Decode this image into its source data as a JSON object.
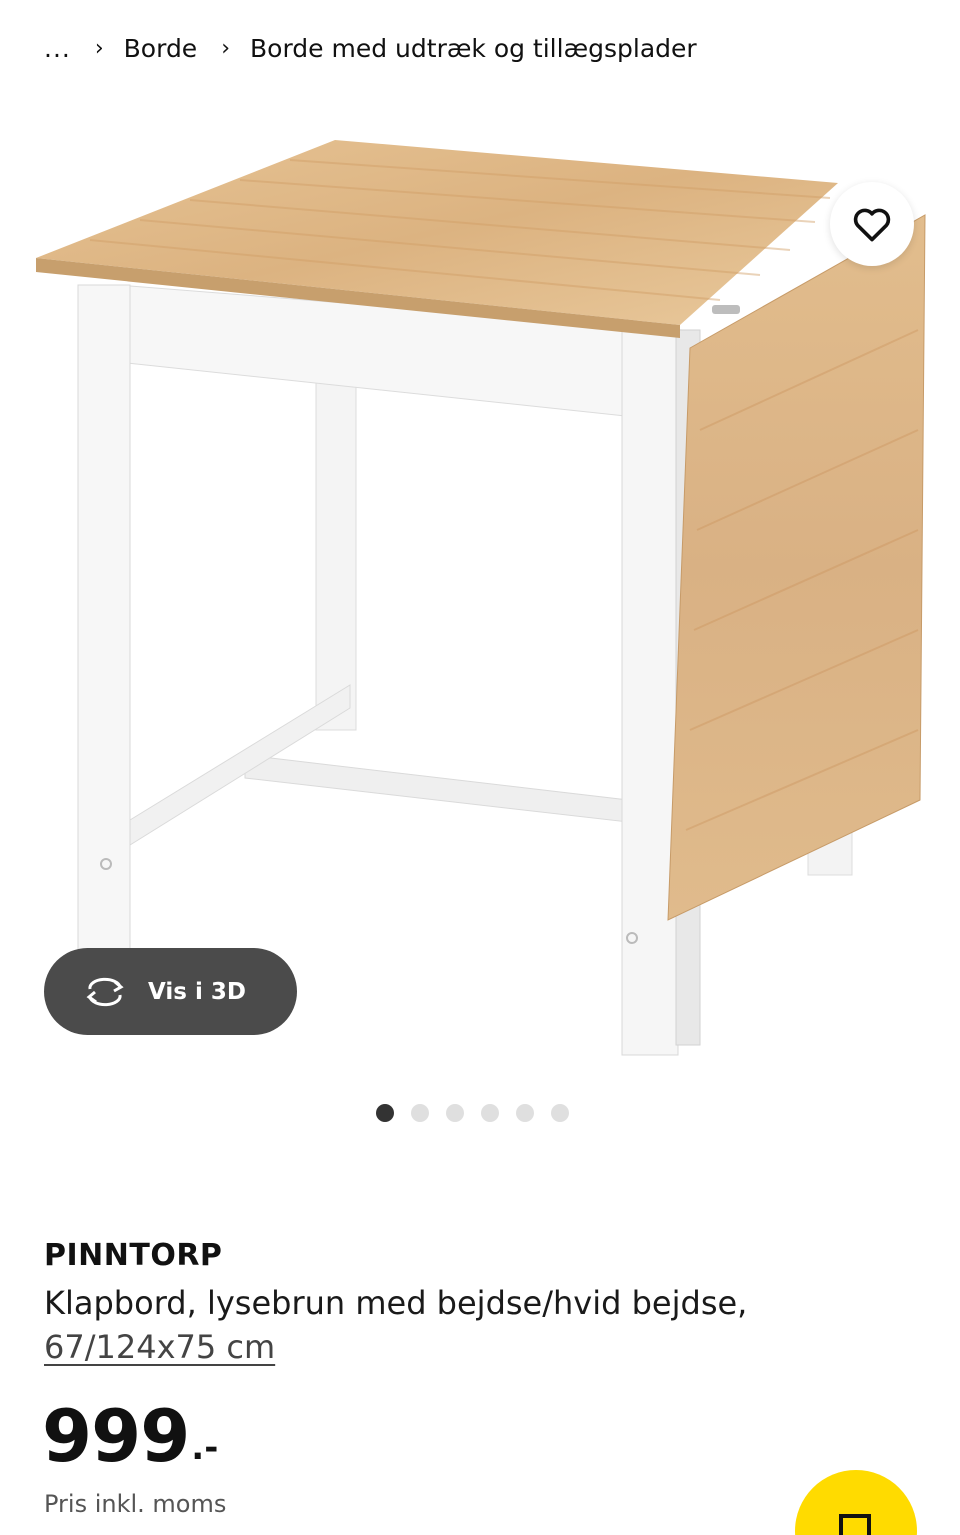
{
  "breadcrumb": {
    "ellipsis": "...",
    "items": [
      "Borde",
      "Borde med udtræk og tillægsplader"
    ]
  },
  "gallery": {
    "favorite_icon": "heart-icon",
    "view_3d_label": "Vis i 3D",
    "view_3d_icon": "rotate-3d-icon",
    "image_count": 6,
    "active_index": 0
  },
  "product": {
    "name": "PINNTORP",
    "description": "Klapbord, lysebrun med bejdse/hvid bejdse,",
    "size": "67/124x75 cm",
    "price_integer": "999",
    "price_suffix": ".-",
    "price_note": "Pris inkl. moms"
  },
  "cart": {
    "icon": "shopping-bag-icon",
    "color": "#ffdb00"
  }
}
